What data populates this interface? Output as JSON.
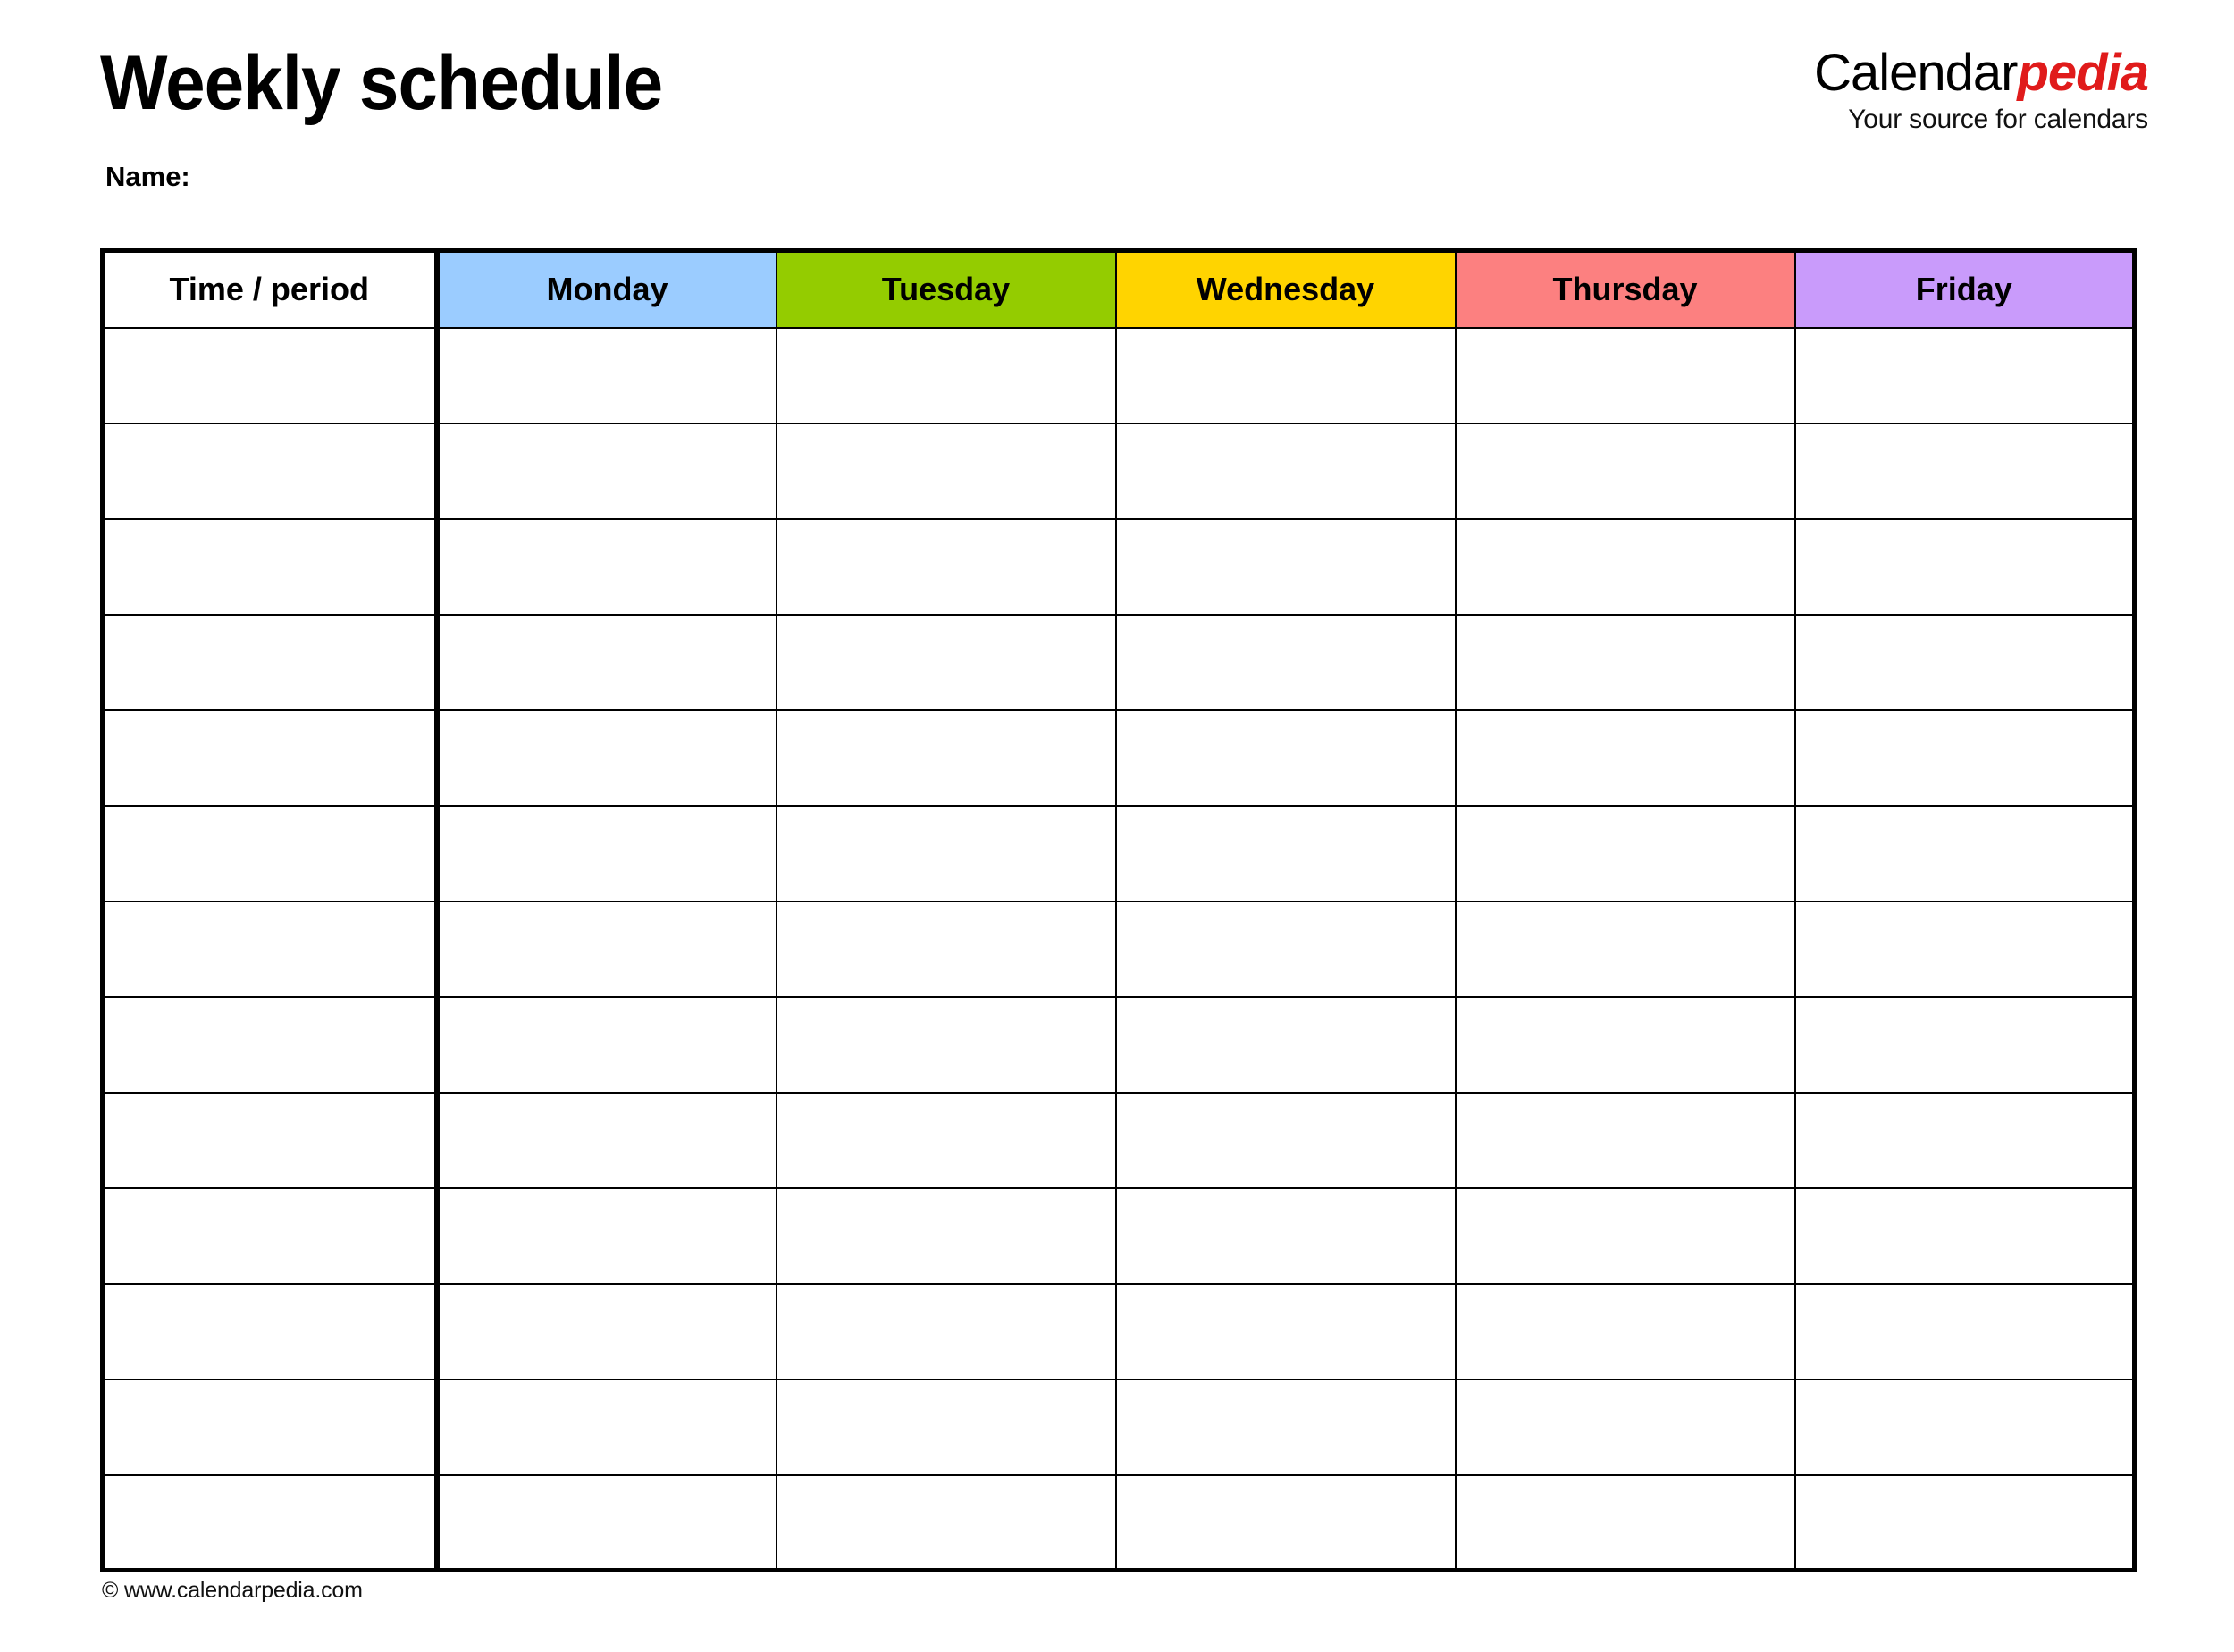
{
  "document": {
    "title": "Weekly schedule",
    "name_label": "Name:"
  },
  "logo": {
    "brand_first": "Calendar",
    "brand_second": "pedia",
    "tagline": "Your source for calendars",
    "brand_color": "#E01B1B",
    "brand_first_color": "#000000"
  },
  "table": {
    "columns": [
      {
        "key": "time",
        "label": "Time / period",
        "header_bg": "#ffffff"
      },
      {
        "key": "monday",
        "label": "Monday",
        "header_bg": "#9BCCFF"
      },
      {
        "key": "tuesday",
        "label": "Tuesday",
        "header_bg": "#94CC00"
      },
      {
        "key": "wednesday",
        "label": "Wednesday",
        "header_bg": "#FFD400"
      },
      {
        "key": "thursday",
        "label": "Thursday",
        "header_bg": "#FC8080"
      },
      {
        "key": "friday",
        "label": "Friday",
        "header_bg": "#C99BFB"
      }
    ],
    "row_count": 13,
    "rows": [
      {
        "time": "",
        "monday": "",
        "tuesday": "",
        "wednesday": "",
        "thursday": "",
        "friday": ""
      },
      {
        "time": "",
        "monday": "",
        "tuesday": "",
        "wednesday": "",
        "thursday": "",
        "friday": ""
      },
      {
        "time": "",
        "monday": "",
        "tuesday": "",
        "wednesday": "",
        "thursday": "",
        "friday": ""
      },
      {
        "time": "",
        "monday": "",
        "tuesday": "",
        "wednesday": "",
        "thursday": "",
        "friday": ""
      },
      {
        "time": "",
        "monday": "",
        "tuesday": "",
        "wednesday": "",
        "thursday": "",
        "friday": ""
      },
      {
        "time": "",
        "monday": "",
        "tuesday": "",
        "wednesday": "",
        "thursday": "",
        "friday": ""
      },
      {
        "time": "",
        "monday": "",
        "tuesday": "",
        "wednesday": "",
        "thursday": "",
        "friday": ""
      },
      {
        "time": "",
        "monday": "",
        "tuesday": "",
        "wednesday": "",
        "thursday": "",
        "friday": ""
      },
      {
        "time": "",
        "monday": "",
        "tuesday": "",
        "wednesday": "",
        "thursday": "",
        "friday": ""
      },
      {
        "time": "",
        "monday": "",
        "tuesday": "",
        "wednesday": "",
        "thursday": "",
        "friday": ""
      },
      {
        "time": "",
        "monday": "",
        "tuesday": "",
        "wednesday": "",
        "thursday": "",
        "friday": ""
      },
      {
        "time": "",
        "monday": "",
        "tuesday": "",
        "wednesday": "",
        "thursday": "",
        "friday": ""
      },
      {
        "time": "",
        "monday": "",
        "tuesday": "",
        "wednesday": "",
        "thursday": "",
        "friday": ""
      }
    ]
  },
  "footer": {
    "copyright": "© www.calendarpedia.com"
  }
}
